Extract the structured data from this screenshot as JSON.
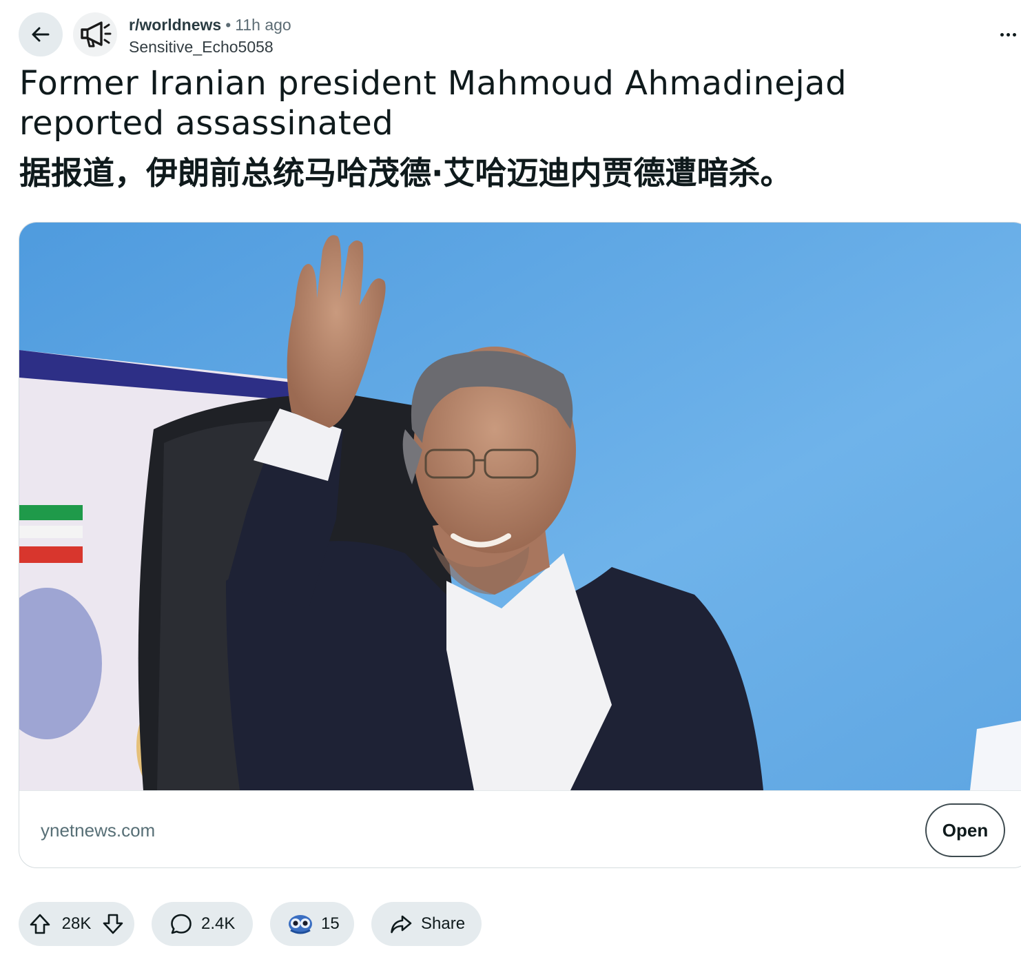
{
  "header": {
    "subreddit": "r/worldnews",
    "separator": "•",
    "time_ago": "11h ago",
    "author": "Sensitive_Echo5058"
  },
  "post": {
    "title": "Former Iranian president Mahmoud Ahmadinejad reported assassinated",
    "subtitle_cn": "据报道，伊朗前总统马哈茂德·艾哈迈迪内贾德遭暗杀。"
  },
  "link_card": {
    "domain": "ynetnews.com",
    "open_label": "Open"
  },
  "actions": {
    "upvotes": "28K",
    "comments": "2.4K",
    "awards": "15",
    "share_label": "Share"
  },
  "icons": {
    "back": "arrow-left-icon",
    "subreddit": "megaphone-icon",
    "more": "ellipsis-icon",
    "upvote": "upvote-arrow-icon",
    "downvote": "downvote-arrow-icon",
    "comment": "comment-bubble-icon",
    "award": "award-icon",
    "share": "share-arrow-icon"
  },
  "colors": {
    "pill_bg": "#e5ebee",
    "text": "#0f1a1c",
    "muted": "#5c6c74",
    "photo_sky": "#63a9e4"
  }
}
